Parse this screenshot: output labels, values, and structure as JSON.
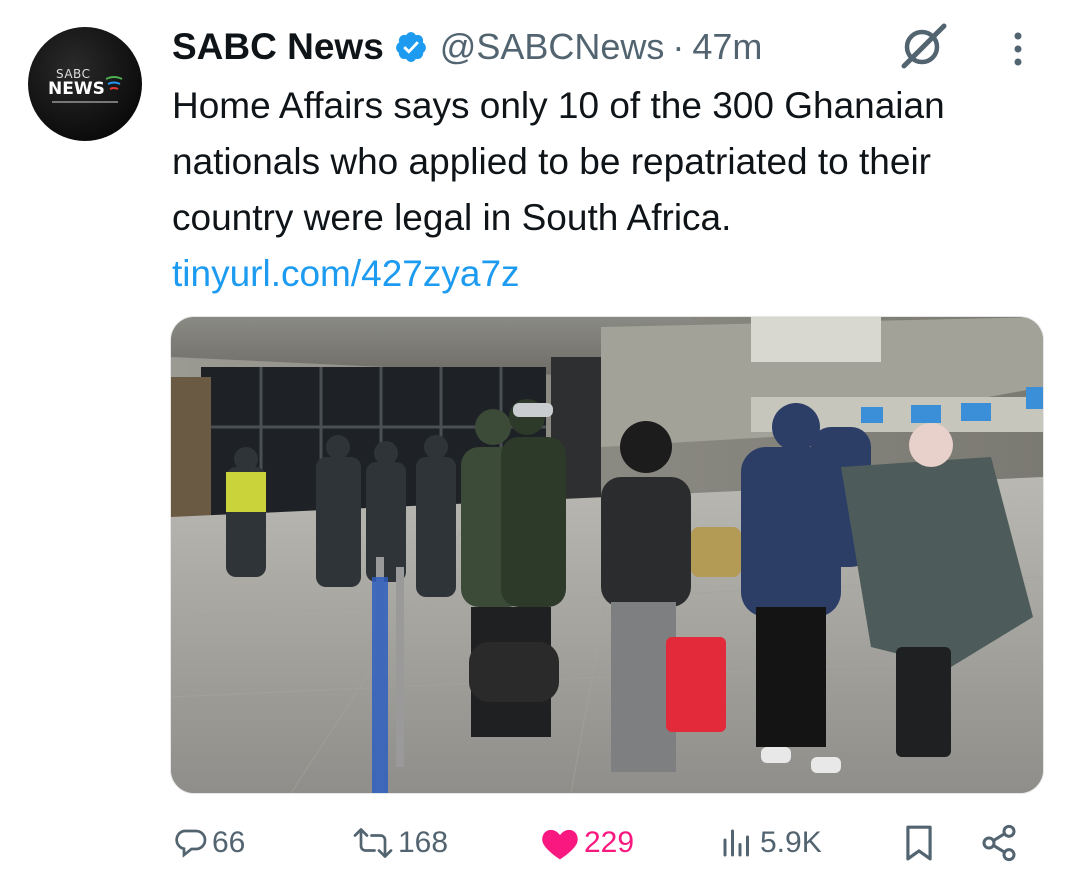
{
  "author": {
    "display_name": "SABC News",
    "handle": "@SABCNews",
    "separator": "·",
    "time": "47m",
    "verified": true,
    "avatar_logo": {
      "small_text": "SABC",
      "main_text": "NEWS"
    }
  },
  "tweet": {
    "text": "Home Affairs says only 10 of the 300 Ghanaian nationals who applied to be repatriated to their country were legal in South Africa. ",
    "link": "tinyurl.com/427zya7z"
  },
  "icons": {
    "verified": "verified-badge-icon",
    "grok": "grok-icon",
    "more": "more-options-icon",
    "reply": "reply-icon",
    "repost": "repost-icon",
    "like": "heart-icon",
    "views": "views-icon",
    "bookmark": "bookmark-icon",
    "share": "share-icon"
  },
  "actions": {
    "replies": "66",
    "reposts": "168",
    "likes": "229",
    "views": "5.9K"
  },
  "colors": {
    "text": "#0f1419",
    "secondary": "#536471",
    "link": "#1d9bf0",
    "like": "#f91880"
  }
}
